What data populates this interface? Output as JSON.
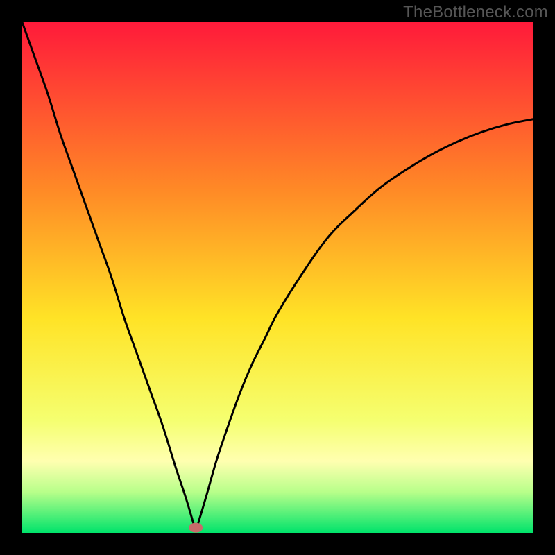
{
  "watermark": "TheBottleneck.com",
  "colors": {
    "frame": "#000000",
    "gradient_top": "#ff1a3a",
    "gradient_mid_upper": "#ff8a26",
    "gradient_mid": "#ffe326",
    "gradient_lower": "#f5ff70",
    "gradient_band": "#ffffb0",
    "gradient_green_top": "#b8ff8a",
    "gradient_bottom": "#00e36b",
    "curve": "#000000",
    "marker": "#c76a6a"
  },
  "chart_data": {
    "type": "line",
    "title": "",
    "xlabel": "",
    "ylabel": "",
    "xlim": [
      0,
      100
    ],
    "ylim": [
      0,
      100
    ],
    "marker": {
      "x": 34,
      "y": 1
    },
    "series": [
      {
        "name": "bottleneck-curve",
        "x": [
          0,
          2.5,
          5,
          7.5,
          10,
          12.5,
          15,
          17.5,
          20,
          22.5,
          25,
          27.5,
          30,
          32,
          33.5,
          34,
          34.5,
          36,
          38,
          40,
          42.5,
          45,
          47.5,
          50,
          55,
          60,
          65,
          70,
          75,
          80,
          85,
          90,
          95,
          100
        ],
        "y": [
          100,
          93,
          86,
          78,
          71,
          64,
          57,
          50,
          42,
          35,
          28,
          21,
          13,
          7,
          2,
          0.5,
          2,
          7,
          14,
          20,
          27,
          33,
          38,
          43,
          51,
          58,
          63,
          67.5,
          71,
          74,
          76.5,
          78.5,
          80,
          81
        ]
      }
    ]
  }
}
